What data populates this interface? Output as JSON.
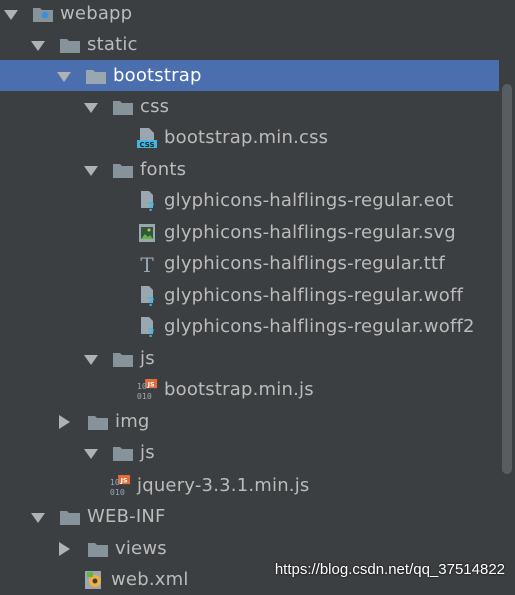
{
  "tree": {
    "webapp": "webapp",
    "static": "static",
    "bootstrap": "bootstrap",
    "css": "css",
    "bootstrap_min_css": "bootstrap.min.css",
    "fonts": "fonts",
    "font_eot": "glyphicons-halflings-regular.eot",
    "font_svg": "glyphicons-halflings-regular.svg",
    "font_ttf": "glyphicons-halflings-regular.ttf",
    "font_woff": "glyphicons-halflings-regular.woff",
    "font_woff2": "glyphicons-halflings-regular.woff2",
    "js_sub": "js",
    "bootstrap_min_js": "bootstrap.min.js",
    "img": "img",
    "js": "js",
    "jquery_min_js": "jquery-3.3.1.min.js",
    "web_inf": "WEB-INF",
    "views": "views",
    "web_xml": "web.xml"
  },
  "watermark": "https://blog.csdn.net/qq_37514822",
  "colors": {
    "selection": "#4b6eaf",
    "background": "#3c3f41",
    "folder": "#87939a"
  }
}
